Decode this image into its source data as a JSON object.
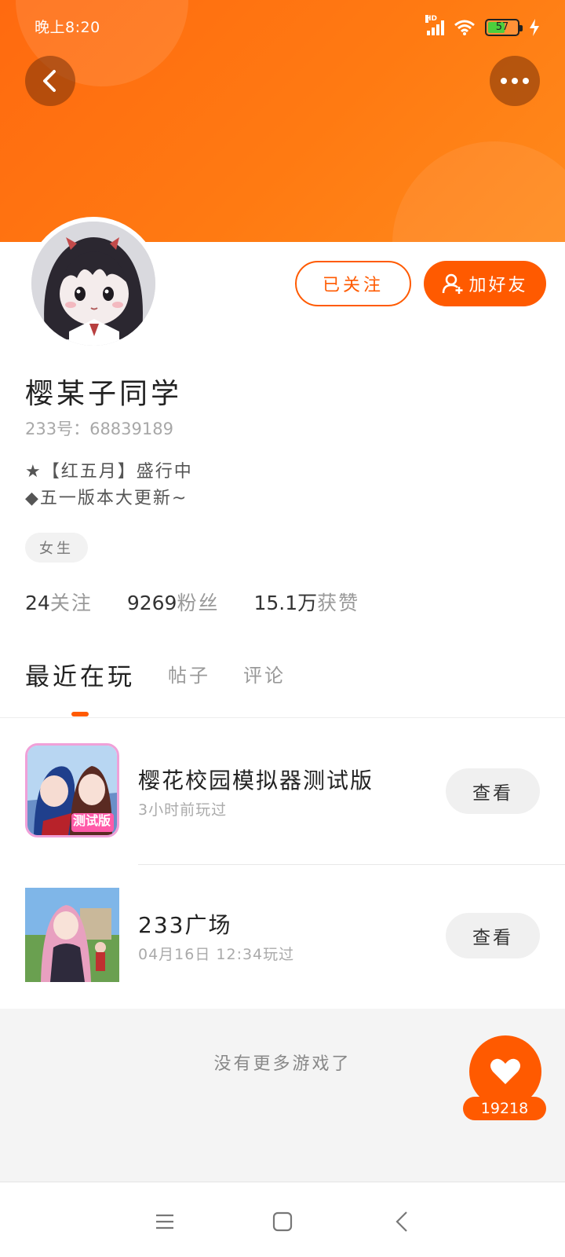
{
  "status_bar": {
    "time": "晚上8:20",
    "network": "HD",
    "battery": "57",
    "battery_level": 0.57
  },
  "header": {
    "back_icon": "chevron-left-icon",
    "more_icon": "more-horizontal-icon"
  },
  "profile": {
    "nickname": "樱某子同学",
    "uid": "233号：68839189",
    "bio_line1": "★【红五月】盛行中",
    "bio_line2": "◆五一版本大更新~",
    "tag": "女生",
    "followed_label": "已关注",
    "add_friend_label": "加好友",
    "stats": [
      {
        "num": "24",
        "label": "关注"
      },
      {
        "num": "9269",
        "label": "粉丝"
      },
      {
        "num": "15.1万",
        "label": "获赞"
      }
    ]
  },
  "tabs": [
    {
      "label": "最近在玩"
    },
    {
      "label": "帖子"
    },
    {
      "label": "评论"
    }
  ],
  "games": [
    {
      "title": "樱花校园模拟器测试版",
      "time": "3小时前玩过",
      "action": "查看",
      "badge": "测试版"
    },
    {
      "title": "233广场",
      "time": "04月16日 12:34玩过",
      "action": "查看"
    }
  ],
  "footer": {
    "no_more_text": "没有更多游戏了",
    "like_count": "19218"
  },
  "colors": {
    "accent": "#ff5a00",
    "banner": "#ff7a12"
  }
}
